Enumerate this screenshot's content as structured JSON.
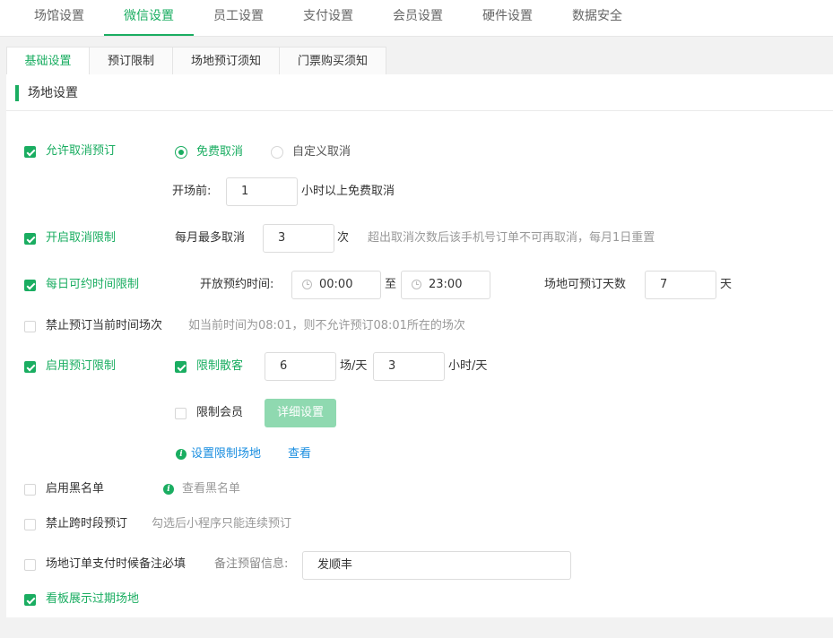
{
  "top_tabs": [
    "场馆设置",
    "微信设置",
    "员工设置",
    "支付设置",
    "会员设置",
    "硬件设置",
    "数据安全"
  ],
  "sub_tabs": [
    "基础设置",
    "预订限制",
    "场地预订须知",
    "门票购买须知"
  ],
  "section_title": "场地设置",
  "cancel_booking": {
    "label": "允许取消预订",
    "checked": true,
    "free_cancel": "免费取消",
    "custom_cancel": "自定义取消",
    "before_label": "开场前:",
    "hours_value": "1",
    "hours_suffix": "小时以上免费取消"
  },
  "cancel_limit": {
    "label": "开启取消限制",
    "checked": true,
    "monthly_label": "每月最多取消",
    "monthly_value": "3",
    "unit": "次",
    "hint": "超出取消次数后该手机号订单不可再取消，每月1日重置"
  },
  "daily_time": {
    "label": "每日可约时间限制",
    "checked": true,
    "open_label": "开放预约时间:",
    "start_time": "00:00",
    "to": "至",
    "end_time": "23:00",
    "days_label": "场地可预订天数",
    "days_value": "7",
    "days_unit": "天"
  },
  "forbid_current": {
    "label": "禁止预订当前时间场次",
    "checked": false,
    "hint": "如当前时间为08:01，则不允许预订08:01所在的场次"
  },
  "booking_limit": {
    "label": "启用预订限制",
    "checked": true,
    "guest_label": "限制散客",
    "guest_checked": true,
    "sessions_value": "6",
    "sessions_unit": "场/天",
    "hours_value": "3",
    "hours_unit": "小时/天",
    "member_label": "限制会员",
    "member_checked": false,
    "detail_button": "详细设置",
    "venue_link": "设置限制场地",
    "view_link": "查看"
  },
  "blacklist": {
    "label": "启用黑名单",
    "checked": false,
    "view_link": "查看黑名单"
  },
  "cross_period": {
    "label": "禁止跨时段预订",
    "checked": false,
    "hint": "勾选后小程序只能连续预订"
  },
  "remark_required": {
    "label": "场地订单支付时候备注必填",
    "checked": false,
    "remark_label": "备注预留信息:",
    "remark_value": "发顺丰"
  },
  "expired_board": {
    "label": "看板展示过期场地",
    "checked": true
  },
  "colors": {
    "accent": "#1aad61",
    "link": "#1a8ee0",
    "disabled_button": "#8fd9b0"
  }
}
